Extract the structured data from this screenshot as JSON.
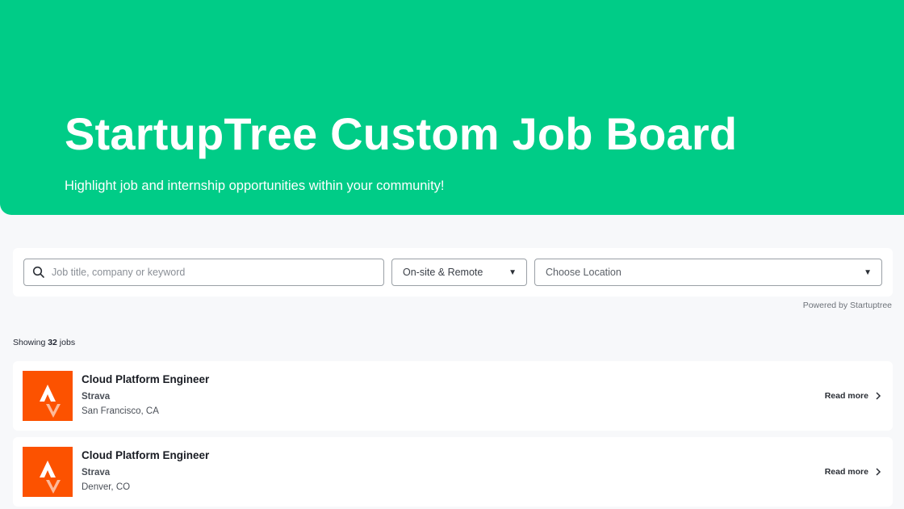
{
  "hero": {
    "title": "StartupTree Custom Job Board",
    "subtitle": "Highlight job and internship opportunities within your community!",
    "background_color": "#00cc87"
  },
  "filters": {
    "search_placeholder": "Job title, company or keyword",
    "search_value": "",
    "work_type_selected": "On-site & Remote",
    "location_placeholder": "Choose Location",
    "icons": {
      "search": "search-icon",
      "dropdown": "caret-down-icon"
    }
  },
  "powered_by": "Powered by Startuptree",
  "results": {
    "showing_prefix": "Showing ",
    "count": "32",
    "showing_suffix": " jobs"
  },
  "jobs": [
    {
      "title": "Cloud Platform Engineer",
      "company": "Strava",
      "location": "San Francisco, CA",
      "action_label": "Read more"
    },
    {
      "title": "Cloud Platform Engineer",
      "company": "Strava",
      "location": "Denver, CO",
      "action_label": "Read more"
    }
  ],
  "colors": {
    "brand_green": "#00cc87",
    "strava_orange": "#fc5200",
    "page_background": "#f7f8fa"
  }
}
